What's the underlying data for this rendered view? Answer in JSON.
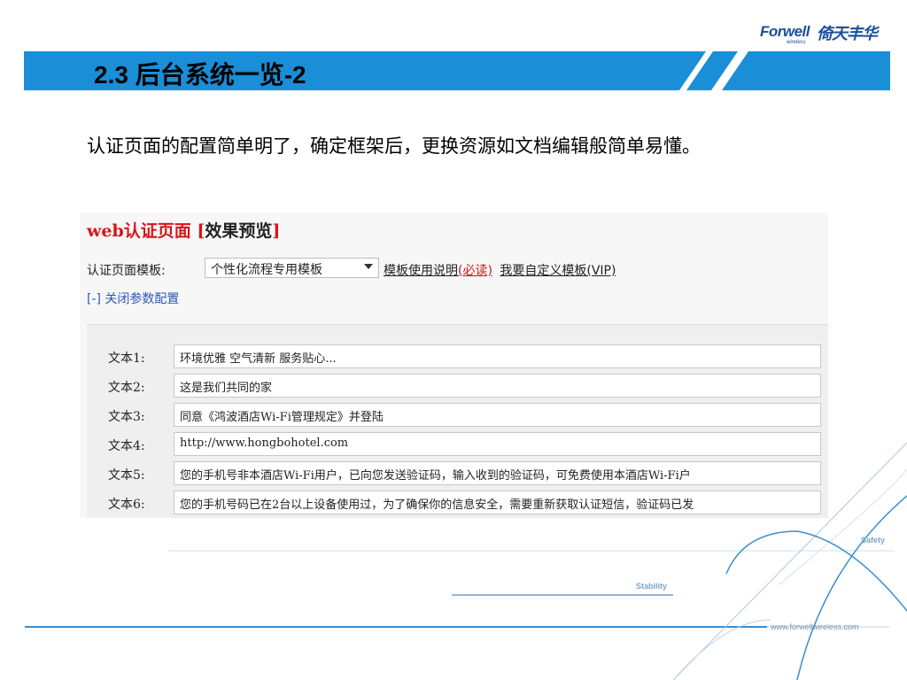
{
  "slide": {
    "logo": {
      "brand_en": "Forwell",
      "brand_sub": "wireless",
      "brand_cn": "倚天丰华"
    },
    "title": "2.3 后台系统一览-2",
    "description": "认证页面的配置简单明了，确定框架后，更换资源如文档编辑般简单易懂。",
    "tags": {
      "safety": "Safety",
      "stability": "Stability",
      "url": "www.forwellwireless.com"
    }
  },
  "panel": {
    "header_web": "web认证页面",
    "header_open": "[",
    "header_preview": "效果预览",
    "header_close": "]",
    "template_label": "认证页面模板:",
    "template_selected": "个性化流程专用模板",
    "link_usage": "模板使用说明",
    "link_must": "(必读)",
    "link_custom": "我要自定义模板(VIP)",
    "toggle_label": "[-] 关闭参数配置",
    "fields": [
      {
        "label": "文本1:",
        "value": "环境优雅 空气清新 服务贴心..."
      },
      {
        "label": "文本2:",
        "value": "这是我们共同的家"
      },
      {
        "label": "文本3:",
        "value": "同意《鸿波酒店Wi-Fi管理规定》并登陆"
      },
      {
        "label": "文本4:",
        "value": "http://www.hongbohotel.com"
      },
      {
        "label": "文本5:",
        "value": "您的手机号非本酒店Wi-Fi用户，已向您发送验证码，输入收到的验证码，可免费使用本酒店Wi-Fi户"
      },
      {
        "label": "文本6:",
        "value": "您的手机号码已在2台以上设备使用过，为了确保你的信息安全，需要重新获取认证短信，验证码已发"
      }
    ]
  },
  "colors": {
    "title_band": "#1a8fd8",
    "accent_red": "#d9141a",
    "link_blue": "#2b58b8",
    "deco_line": "#3a8fd0"
  }
}
